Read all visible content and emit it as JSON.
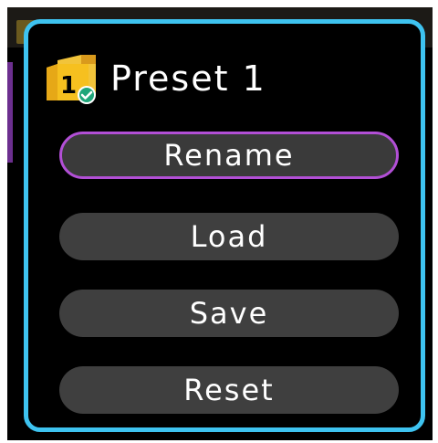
{
  "dialog": {
    "title": "Preset 1",
    "icon": "folder-preset-checked-icon",
    "icon_number": "1",
    "border_color": "#3ec3f0",
    "selection_color": "#b24fd6"
  },
  "menu": {
    "items": [
      {
        "label": "Rename",
        "selected": true
      },
      {
        "label": "Load",
        "selected": false
      },
      {
        "label": "Save",
        "selected": false
      },
      {
        "label": "Reset",
        "selected": false
      }
    ]
  }
}
